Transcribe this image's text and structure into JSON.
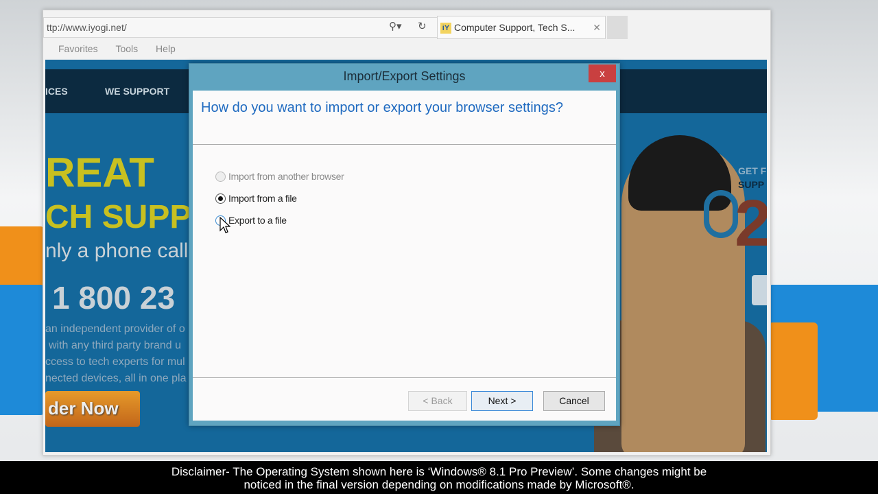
{
  "browser": {
    "address": "ttp://www.iyogi.net/",
    "address_domain": "iyogi",
    "tab_title": "Computer Support, Tech S...",
    "tab_favicon": "iY",
    "menu": [
      "Favorites",
      "Tools",
      "Help"
    ]
  },
  "website": {
    "nav": [
      "ICES",
      "WE SUPPORT"
    ],
    "hero_line1": "REAT",
    "hero_line2": "CH SUPP",
    "hero_line3": "nly a phone call",
    "phone": "1 800 23",
    "desc": [
      "an independent provider of o",
      "with any third party brand u",
      "ccess to tech experts for mul",
      "nected devices, all in one pla"
    ],
    "order_button": "der Now",
    "side_get": "GET F",
    "side_support": "SUPP",
    "side_number": "2"
  },
  "dialog": {
    "title": "Import/Export Settings",
    "close_label": "x",
    "question": "How do you want to import or export your browser settings?",
    "options": [
      {
        "label": "Import from another browser",
        "state": "disabled"
      },
      {
        "label": "Import from a file",
        "state": "selected"
      },
      {
        "label": "Export to a file",
        "state": "hover"
      }
    ],
    "back": "< Back",
    "next": "Next >",
    "cancel": "Cancel"
  },
  "caption": {
    "line1": "Disclaimer- The Operating System shown here is ‘Windows® 8.1 Pro Preview’. Some changes might be",
    "line2": "noticed in the final version depending on modifications made by Microsoft®."
  },
  "colors": {
    "dialog_frame": "#5fa4c0",
    "close": "#c94040",
    "question": "#1f6ac0",
    "page_bg": "#14679a"
  }
}
